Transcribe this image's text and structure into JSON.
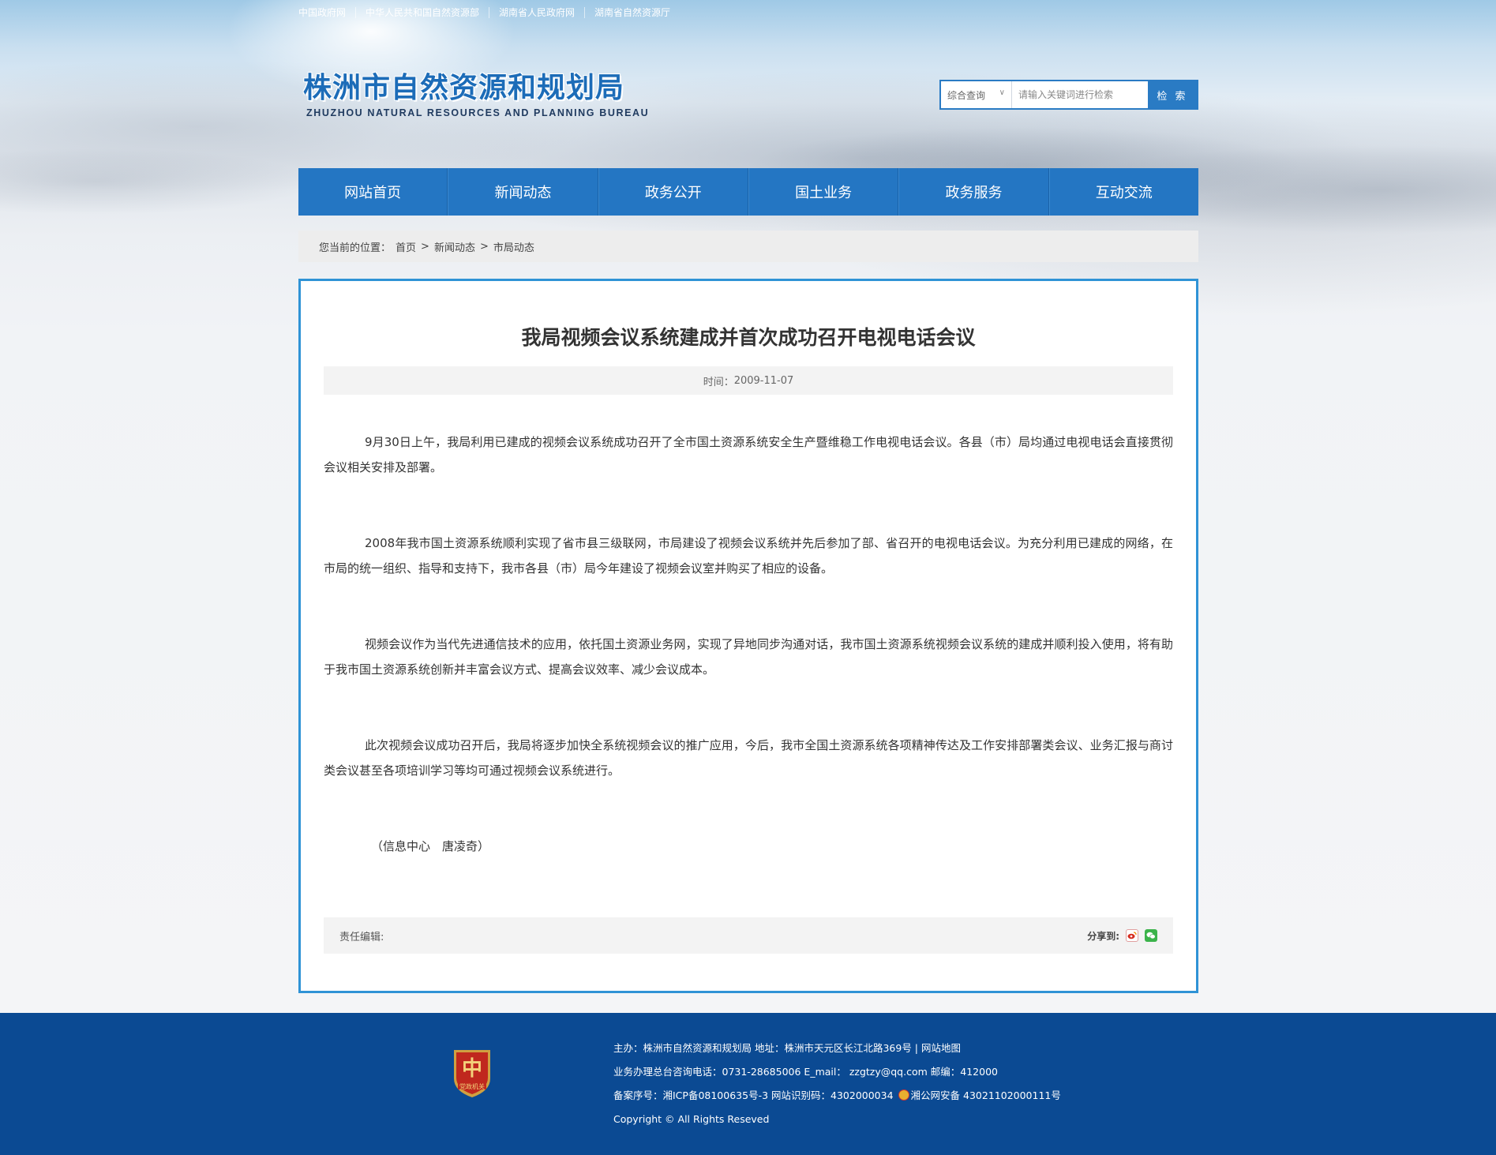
{
  "top_links": [
    "中国政府网",
    "中华人民共和国自然资源部",
    "湖南省人民政府网",
    "湖南省自然资源厅"
  ],
  "logo": {
    "cn": "株洲市自然资源和规划局",
    "en": "ZHUZHOU NATURAL RESOURCES AND PLANNING BUREAU"
  },
  "search": {
    "scope": "综合查询",
    "placeholder": "请输入关键词进行检索",
    "button": "检 索"
  },
  "nav": [
    "网站首页",
    "新闻动态",
    "政务公开",
    "国土业务",
    "政务服务",
    "互动交流"
  ],
  "breadcrumb": {
    "label": "您当前的位置：",
    "items": [
      "首页",
      "新闻动态",
      "市局动态"
    ],
    "separator": ">"
  },
  "article": {
    "title": "我局视频会议系统建成并首次成功召开电视电话会议",
    "time_label": "时间：",
    "time": "2009-11-07",
    "paragraphs": [
      "9月30日上午，我局利用已建成的视频会议系统成功召开了全市国土资源系统安全生产暨维稳工作电视电话会议。各县（市）局均通过电视电话会直接贯彻会议相关安排及部署。",
      "2008年我市国土资源系统顺利实现了省市县三级联网，市局建设了视频会议系统并先后参加了部、省召开的电视电话会议。为充分利用已建成的网络，在市局的统一组织、指导和支持下，我市各县（市）局今年建设了视频会议室并购买了相应的设备。",
      "视频会议作为当代先进通信技术的应用，依托国土资源业务网，实现了异地同步沟通对话，我市国土资源系统视频会议系统的建成并顺利投入使用，将有助于我市国土资源系统创新并丰富会议方式、提高会议效率、减少会议成本。",
      "此次视频会议成功召开后，我局将逐步加快全系统视频会议的推广应用，今后，我市全国土资源系统各项精神传达及工作安排部署类会议、业务汇报与商讨类会议甚至各项培训学习等均可通过视频会议系统进行。"
    ],
    "signature": "（信息中心　唐凌奇）",
    "editor_label": "责任编辑:",
    "share_label": "分享到:"
  },
  "footer": {
    "badge_text": "党政机关",
    "row1": "主办：株洲市自然资源和规划局  地址：株洲市天元区长江北路369号  |  网站地图",
    "row2": "业务办理总台咨询电话：0731-28685006    E_mail：  zzgtzy@qq.com    邮编：412000",
    "row3_a": "备案序号：湘ICP备08100635号-3 网站识别码：4302000034",
    "row3_b": "湘公网安备 43021102000111号",
    "row4": "Copyright © All Rights Reseved"
  },
  "colors": {
    "primary_blue": "#2476c3",
    "content_border": "#2f93d6",
    "footer_bg": "#0b4a93",
    "logo_blue": "#1c6cb8"
  }
}
